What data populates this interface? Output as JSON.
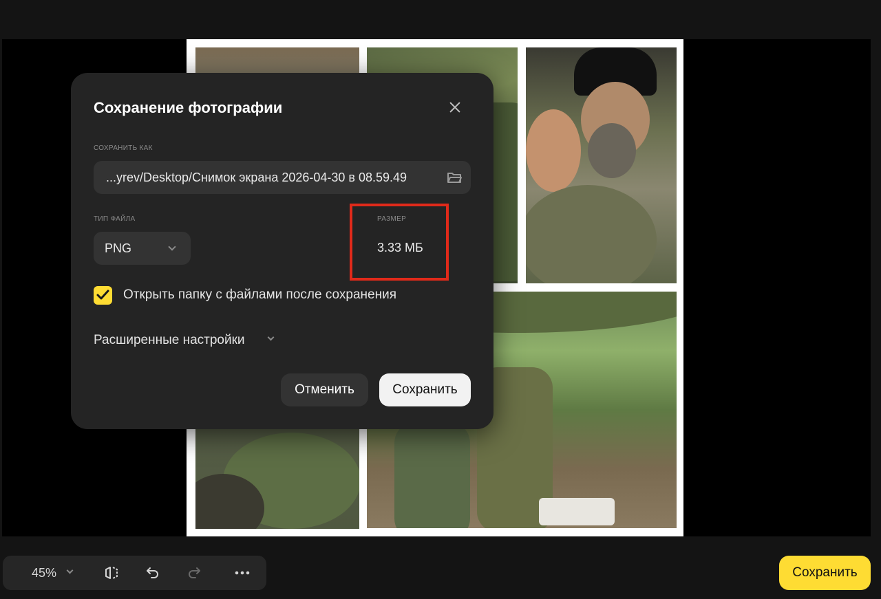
{
  "dialog": {
    "title": "Сохранение фотографии",
    "save_as_label": "СОХРАНИТЬ КАК",
    "path_value": "...yrev/Desktop/Снимок экрана 2026-04-30 в 08.59.49",
    "file_type_label": "ТИП ФАЙЛА",
    "file_type_value": "PNG",
    "size_label": "РАЗМЕР",
    "size_value": "3.33 МБ",
    "open_folder_label": "Открыть папку с файлами после сохранения",
    "open_folder_checked": true,
    "advanced_label": "Расширенные настройки",
    "cancel_label": "Отменить",
    "save_label": "Сохранить"
  },
  "toolbar": {
    "zoom_value": "45%",
    "icons": [
      "flip-icon",
      "undo-icon",
      "redo-icon",
      "more-icon"
    ]
  },
  "main_save_label": "Сохранить",
  "colors": {
    "accent": "#fedc33",
    "highlight": "#e02a1a",
    "dialog_bg": "#242424"
  }
}
